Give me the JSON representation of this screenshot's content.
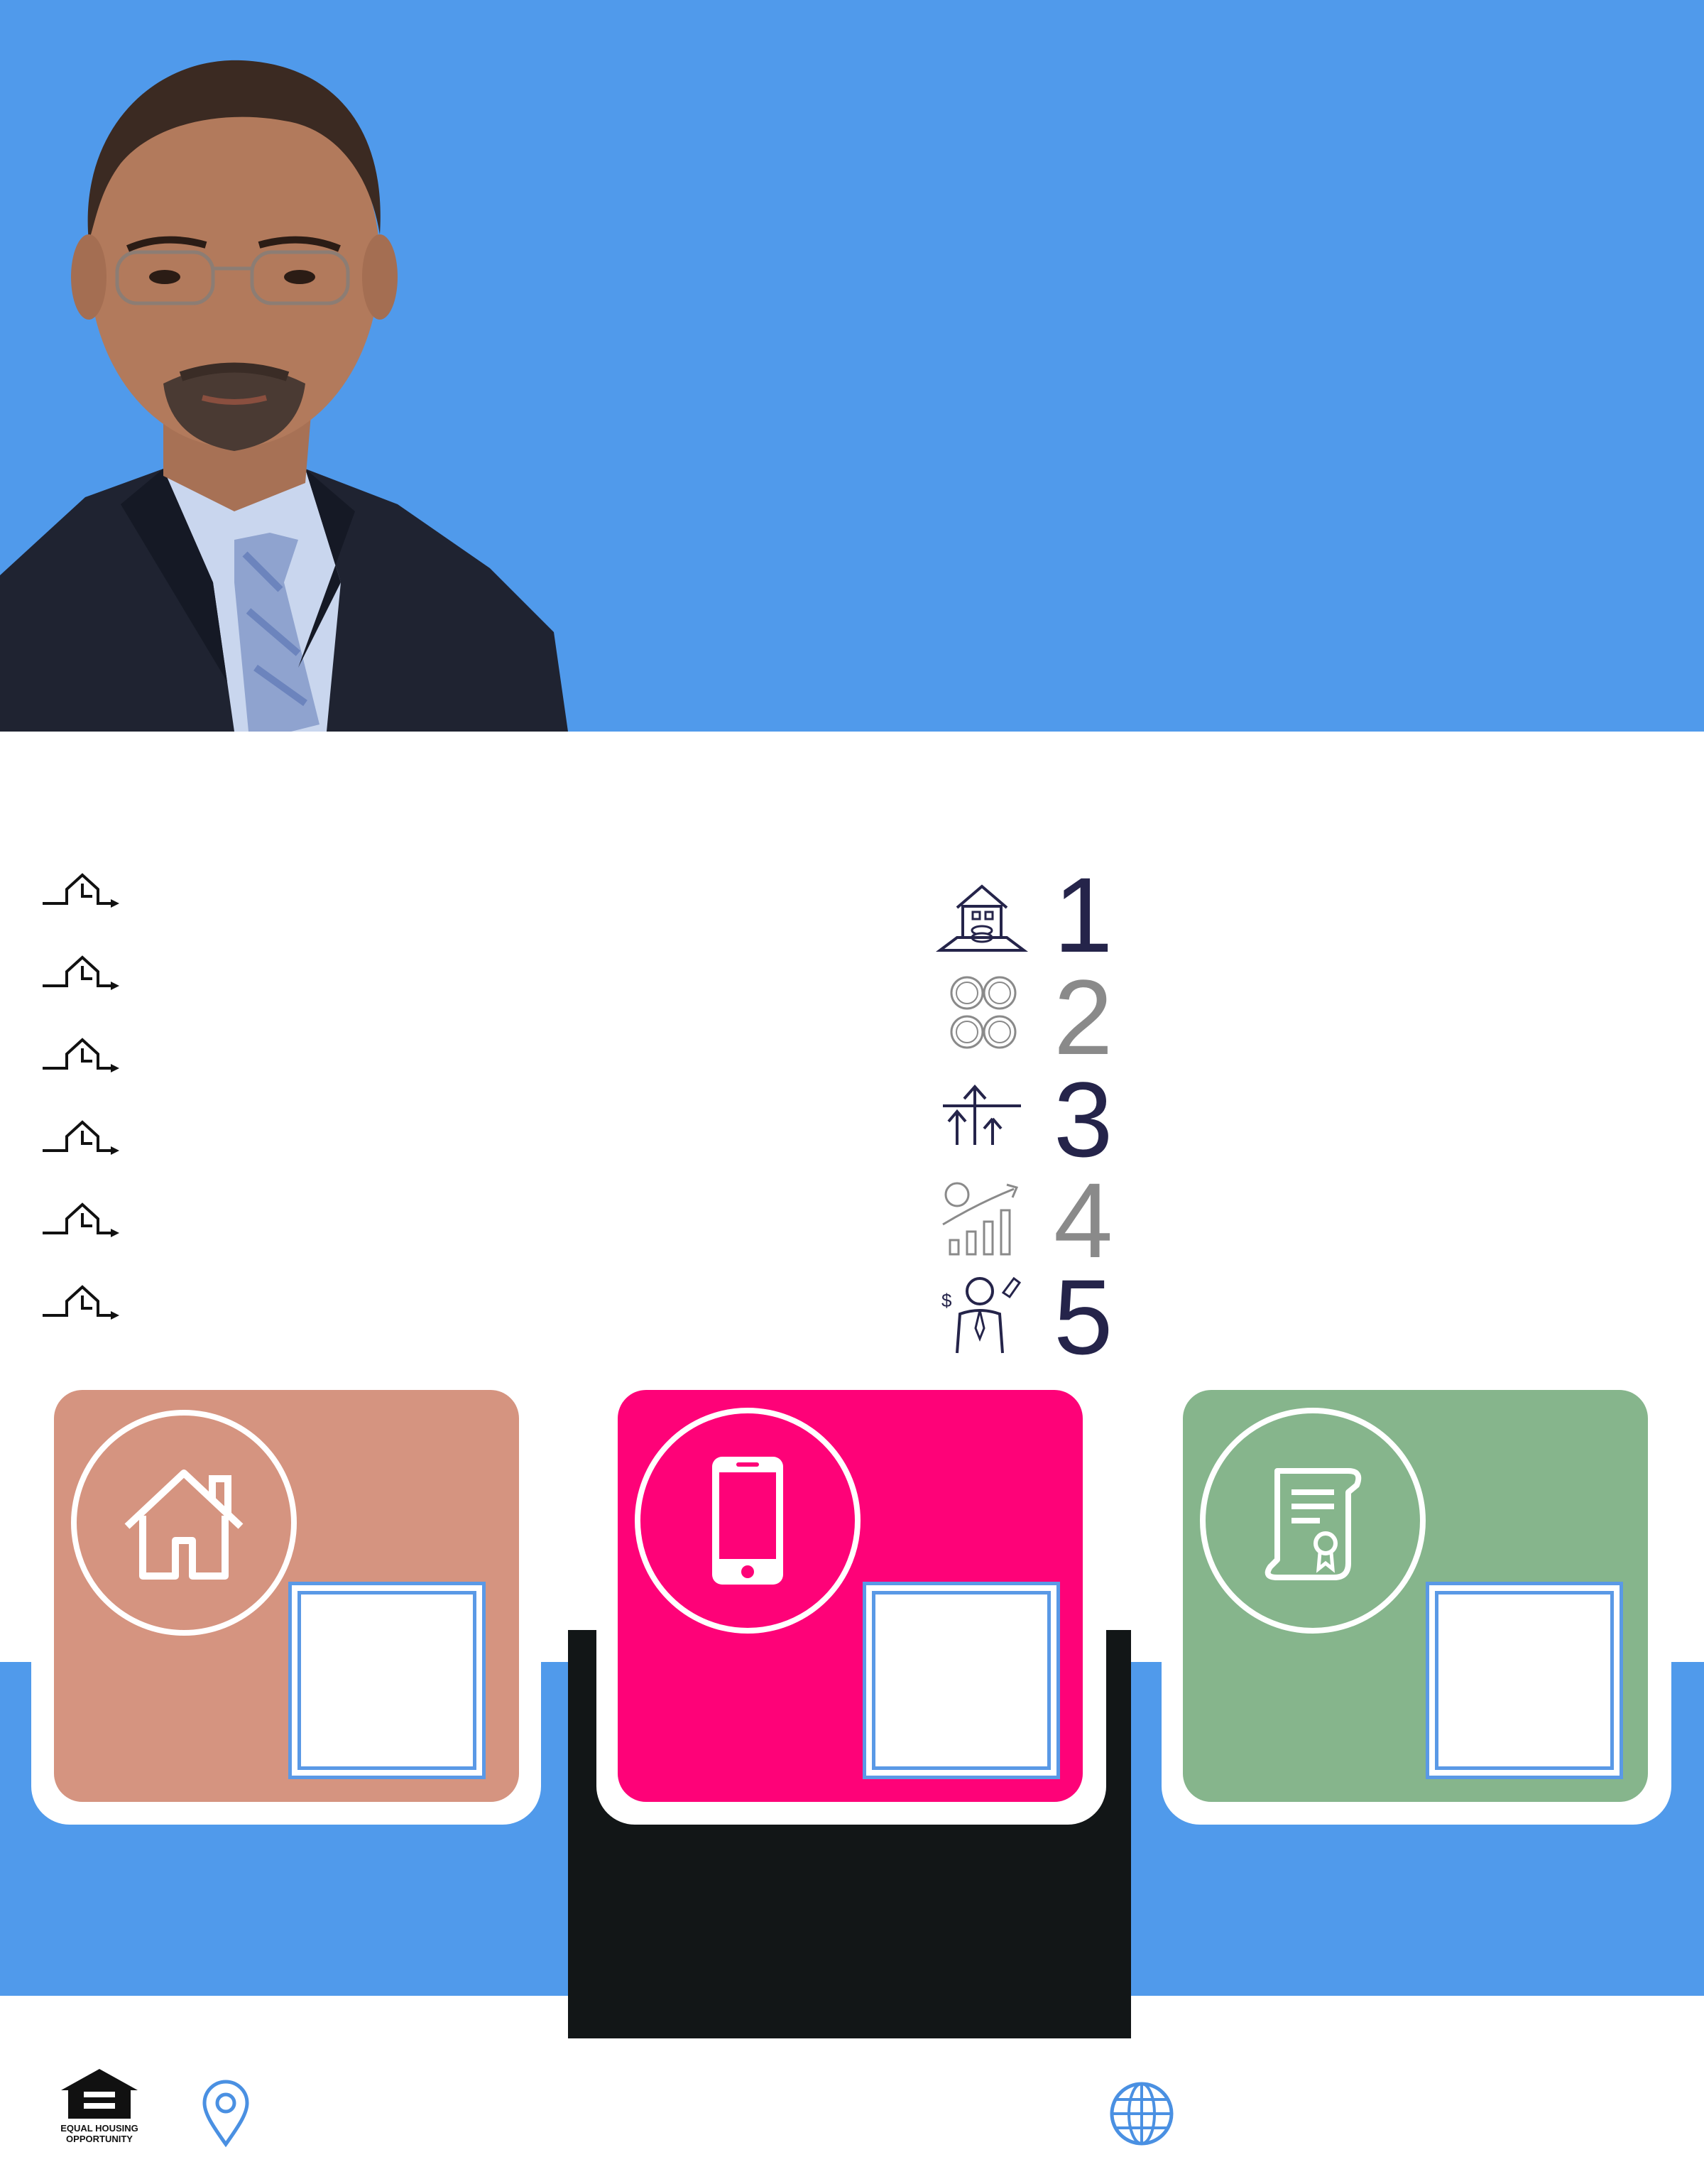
{
  "colors": {
    "brand_blue": "#509aeb",
    "card_house": "#d59480",
    "card_phone": "#fe0278",
    "card_document": "#86b58c",
    "panel_black": "#121617",
    "step_dark": "#25244a",
    "step_gray": "#8a8a8a"
  },
  "header": {
    "portrait_alt": "portrait-photo"
  },
  "bullets": [
    {
      "icon": "stair-arrow-icon"
    },
    {
      "icon": "stair-arrow-icon"
    },
    {
      "icon": "stair-arrow-icon"
    },
    {
      "icon": "stair-arrow-icon"
    },
    {
      "icon": "stair-arrow-icon"
    },
    {
      "icon": "stair-arrow-icon"
    }
  ],
  "steps": [
    {
      "number": "1",
      "icon": "house-coins-icon"
    },
    {
      "number": "2",
      "icon": "coins-icon"
    },
    {
      "number": "3",
      "icon": "growth-arrows-icon"
    },
    {
      "number": "4",
      "icon": "rising-chart-icon"
    },
    {
      "number": "5",
      "icon": "agent-money-icon"
    }
  ],
  "cards": [
    {
      "icon": "house-icon"
    },
    {
      "icon": "smartphone-icon"
    },
    {
      "icon": "certificate-icon"
    }
  ],
  "footer": {
    "logo": "equal-housing-opportunity-logo",
    "logo_text_line1": "EQUAL HOUSING",
    "logo_text_line2": "OPPORTUNITY",
    "location_icon": "location-pin-icon",
    "web_icon": "globe-icon"
  }
}
